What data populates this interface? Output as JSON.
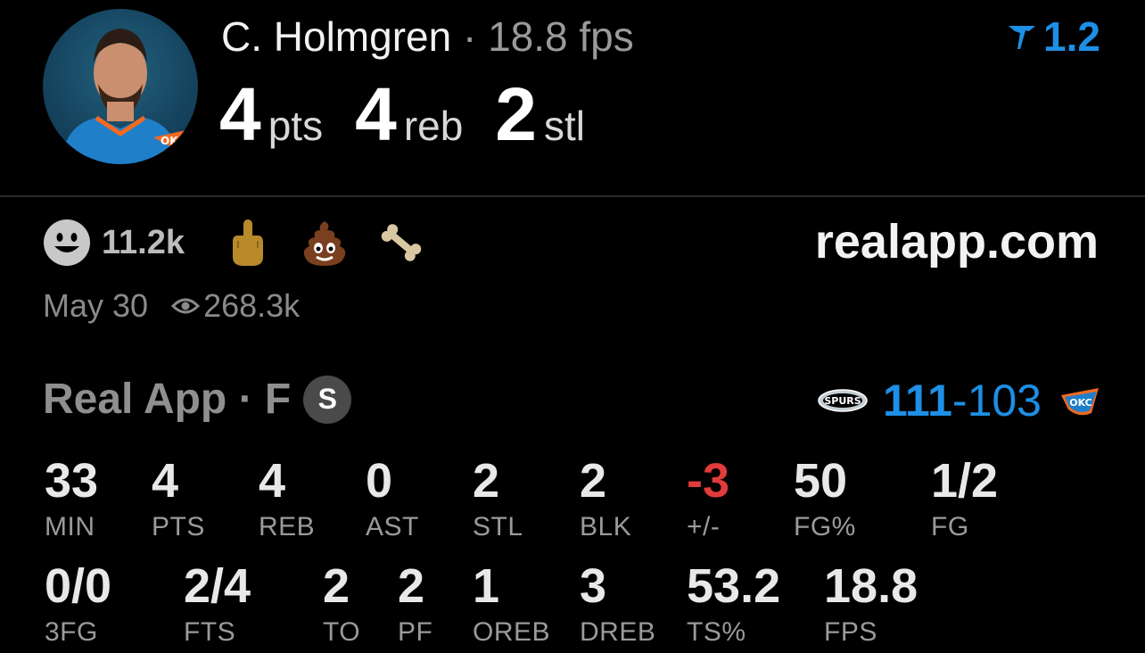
{
  "player": {
    "name": "C. Holmgren",
    "fps_text": " · 18.8 fps",
    "rating": "1.2",
    "headline": [
      {
        "value": "4",
        "label": "pts"
      },
      {
        "value": "4",
        "label": "reb"
      },
      {
        "value": "2",
        "label": "stl"
      }
    ]
  },
  "reactions": {
    "count": "11.2k",
    "emojis": [
      "middle-finger-emoji",
      "poop-emoji",
      "bone-emoji"
    ]
  },
  "site": "realapp.com",
  "meta": {
    "date": "May 30",
    "views": "268.3k"
  },
  "game": {
    "title": "Real App · F",
    "badge": "S",
    "home_score": "111",
    "separator": "-",
    "away_score": "103",
    "home_team_logo": "spurs-logo-icon",
    "away_team_logo": "okc-logo-icon"
  },
  "stats_row1": [
    {
      "value": "33",
      "label": "MIN"
    },
    {
      "value": "4",
      "label": "PTS"
    },
    {
      "value": "4",
      "label": "REB"
    },
    {
      "value": "0",
      "label": "AST"
    },
    {
      "value": "2",
      "label": "STL"
    },
    {
      "value": "2",
      "label": "BLK"
    },
    {
      "value": "-3",
      "label": "+/-"
    },
    {
      "value": "50",
      "label": "FG%"
    },
    {
      "value": "1/2",
      "label": "FG"
    }
  ],
  "stats_row2": [
    {
      "value": "0/0",
      "label": "3FG"
    },
    {
      "value": "2/4",
      "label": "FTS"
    },
    {
      "value": "2",
      "label": "TO"
    },
    {
      "value": "2",
      "label": "PF"
    },
    {
      "value": "1",
      "label": "OREB"
    },
    {
      "value": "3",
      "label": "DREB"
    },
    {
      "value": "53.2",
      "label": "TS%"
    },
    {
      "value": "18.8",
      "label": "FPS"
    }
  ],
  "colors": {
    "accent": "#1d8fe6",
    "negative": "#e23b3b",
    "background": "#000000"
  }
}
